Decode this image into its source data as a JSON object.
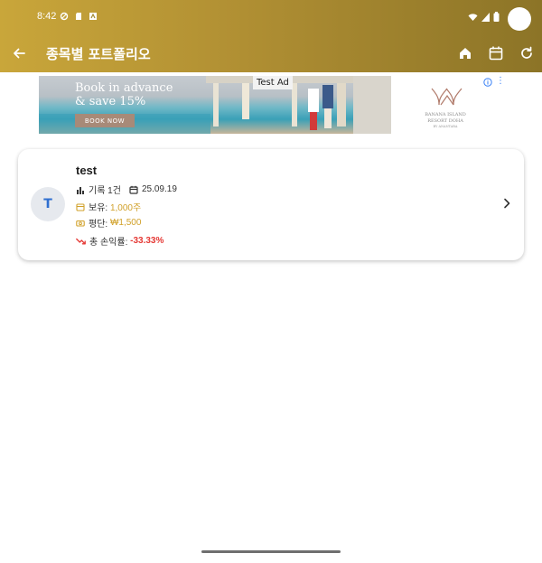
{
  "status_bar": {
    "time": "8:42"
  },
  "app_bar": {
    "title": "종목별 포트폴리오",
    "icons": [
      "back-arrow-icon",
      "home-icon",
      "calendar-icon",
      "refresh-icon"
    ]
  },
  "ad": {
    "headline_line1": "Book in advance",
    "headline_line2": "& save 15%",
    "button_label": "BOOK NOW",
    "tag": "Test Ad",
    "brand_lines": [
      "BANANA ISLAND",
      "RESORT DOHA",
      "BY ANANTARA"
    ]
  },
  "portfolio": [
    {
      "avatar_letter": "T",
      "name": "test",
      "records_label": "기록 1건",
      "date": "25.09.19",
      "holding_label": "보유:",
      "holding_value": "1,000주",
      "avg_label": "평단:",
      "avg_value": "₩1,500",
      "pnl_label": "총 손익률:",
      "pnl_value": "-33.33%"
    }
  ],
  "colors": {
    "brand_gold": "#c9a63a",
    "loss_red": "#e53935",
    "value_gold": "#d1a12a",
    "avatar_blue": "#2f6fd0"
  }
}
